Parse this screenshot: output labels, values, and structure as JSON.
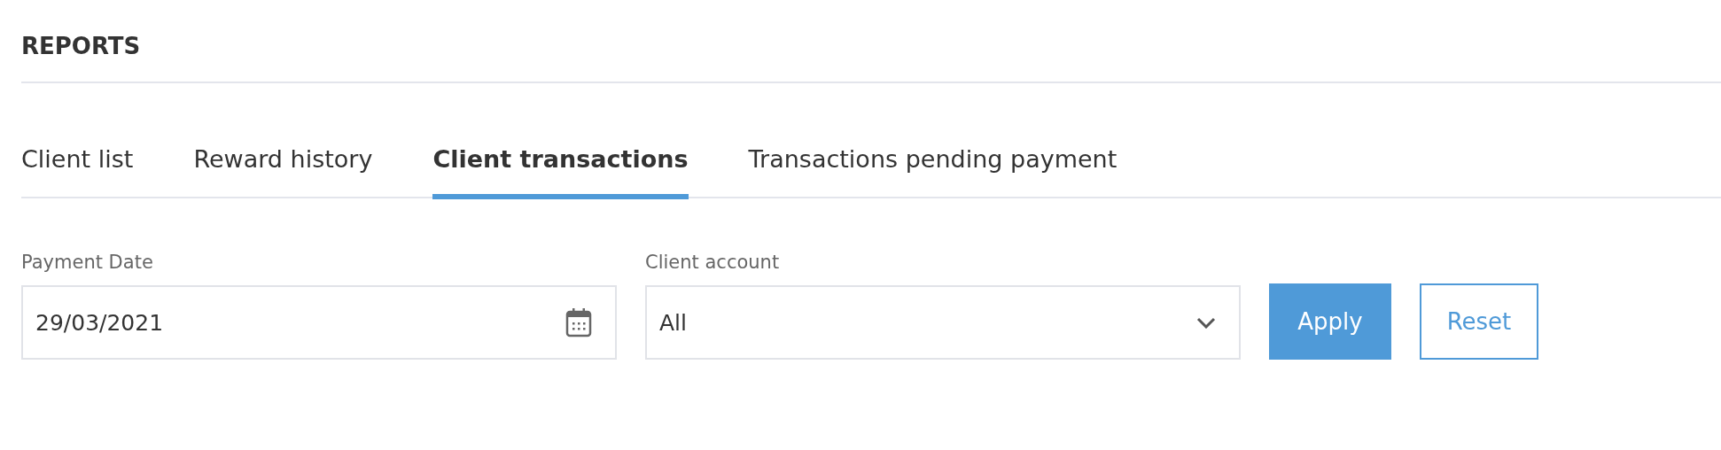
{
  "page": {
    "title": "REPORTS"
  },
  "tabs": [
    {
      "label": "Client list",
      "selected": false
    },
    {
      "label": "Reward history",
      "selected": false
    },
    {
      "label": "Client transactions",
      "selected": true
    },
    {
      "label": "Transactions pending payment",
      "selected": false
    }
  ],
  "filters": [
    {
      "kind": "date",
      "label": "Payment Date",
      "value": "29/03/2021"
    },
    {
      "kind": "select",
      "label": "Client account",
      "value": "All"
    }
  ],
  "buttons": [
    {
      "kind": "primary",
      "label": "Apply"
    },
    {
      "kind": "secondary",
      "label": "Reset"
    }
  ]
}
